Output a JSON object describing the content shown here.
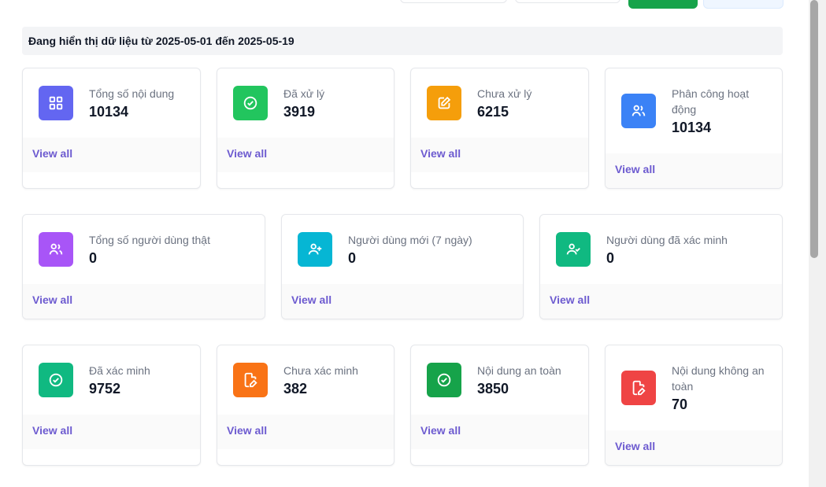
{
  "date_range_text": "Đang hiển thị dữ liệu từ 2025-05-01 đến 2025-05-19",
  "view_all": "View all",
  "row1": [
    {
      "label": "Tổng số nội dung",
      "value": "10134",
      "color": "#6366f1",
      "icon": "grid-icon"
    },
    {
      "label": "Đã xử lý",
      "value": "3919",
      "color": "#22c55e",
      "icon": "check-circle-icon"
    },
    {
      "label": "Chưa xử lý",
      "value": "6215",
      "color": "#f59e0b",
      "icon": "edit-icon"
    },
    {
      "label": "Phân công hoạt động",
      "value": "10134",
      "color": "#3b82f6",
      "icon": "users-icon"
    }
  ],
  "row2": [
    {
      "label": "Tổng số người dùng thật",
      "value": "0",
      "color": "#a855f7",
      "icon": "users-icon"
    },
    {
      "label": "Người dùng mới (7 ngày)",
      "value": "0",
      "color": "#06b6d4",
      "icon": "user-plus-icon"
    },
    {
      "label": "Người dùng đã xác minh",
      "value": "0",
      "color": "#10b981",
      "icon": "user-check-icon"
    }
  ],
  "row3": [
    {
      "label": "Đã xác minh",
      "value": "9752",
      "color": "#10b981",
      "icon": "check-circle-icon"
    },
    {
      "label": "Chưa xác minh",
      "value": "382",
      "color": "#f97316",
      "icon": "file-edit-icon"
    },
    {
      "label": "Nội dung an toàn",
      "value": "3850",
      "color": "#16a34a",
      "icon": "check-circle-icon"
    },
    {
      "label": "Nội dung không an toàn",
      "value": "70",
      "color": "#ef4444",
      "icon": "file-edit-icon"
    }
  ]
}
